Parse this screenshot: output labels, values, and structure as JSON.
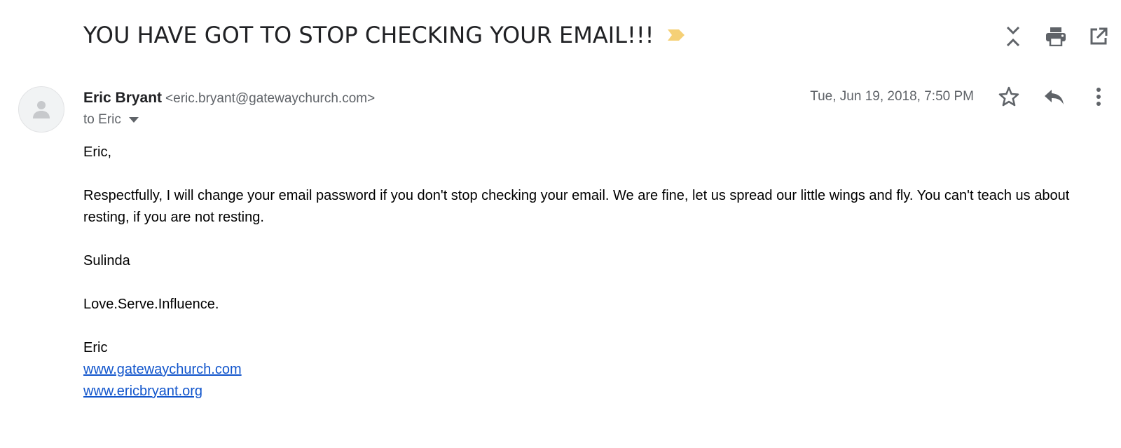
{
  "email": {
    "subject": "YOU HAVE GOT TO STOP CHECKING YOUR EMAIL!!!",
    "importance_marker_color": "#f5d076",
    "sender": {
      "name": "Eric Bryant",
      "email": "<eric.bryant@gatewaychurch.com>"
    },
    "recipient_label": "to Eric",
    "date": "Tue, Jun 19, 2018, 7:50 PM",
    "body": {
      "greeting": "Eric,",
      "paragraph": "Respectfully, I will change your email password if you don't stop checking your email. We are fine, let us spread our little wings and fly. You can't teach us about resting, if you are not resting.",
      "signoff": "Sulinda",
      "motto": "Love.Serve.Influence.",
      "signature_name": "Eric",
      "links": [
        "www.gatewaychurch.com",
        "www.ericbryant.org"
      ]
    }
  },
  "toolbar": {
    "top_icons": [
      "collapse-all-icon",
      "print-icon",
      "open-in-new-window-icon"
    ],
    "message_icons": [
      "star-icon",
      "reply-icon",
      "more-vert-icon"
    ]
  },
  "colors": {
    "text_primary": "#202124",
    "text_secondary": "#5f6368",
    "link": "#1155cc",
    "icon": "#5f6368"
  }
}
